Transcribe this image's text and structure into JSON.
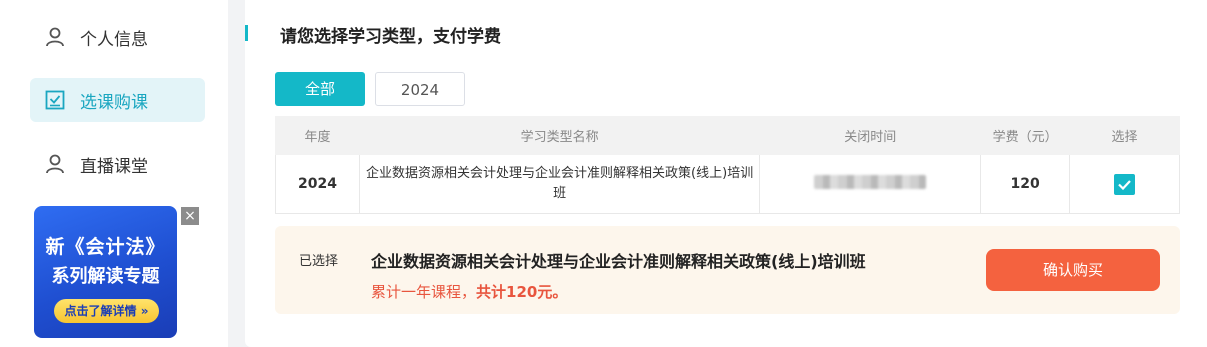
{
  "sidebar": {
    "items": [
      {
        "label": "个人信息",
        "icon": "user-icon",
        "active": false
      },
      {
        "label": "选课购课",
        "icon": "checklist-icon",
        "active": true
      },
      {
        "label": "直播课堂",
        "icon": "user-icon",
        "active": false
      }
    ]
  },
  "ad": {
    "title": "新《会计法》",
    "subtitle": "系列解读专题",
    "button": "点击了解详情 »",
    "close": "×"
  },
  "main": {
    "title": "请您选择学习类型，支付学费",
    "tabs": [
      {
        "label": "全部",
        "active": true
      },
      {
        "label": "2024",
        "active": false
      }
    ],
    "table": {
      "headers": [
        "年度",
        "学习类型名称",
        "关闭时间",
        "学费（元）",
        "选择"
      ],
      "rows": [
        {
          "year": "2024",
          "name": "企业数据资源相关会计处理与企业会计准则解释相关政策(线上)培训班",
          "fee": "120",
          "selected": true
        }
      ]
    },
    "summary": {
      "label": "已选择",
      "course": "企业数据资源相关会计处理与企业会计准则解释相关政策(线上)培训班",
      "total_prefix": "累计一年课程，",
      "total_amount": "共计120元。",
      "confirm": "确认购买"
    }
  },
  "colors": {
    "accent": "#14b8c8",
    "price": "#e8553e",
    "confirm": "#f4623f",
    "summary_bg": "#fdf6ec"
  }
}
